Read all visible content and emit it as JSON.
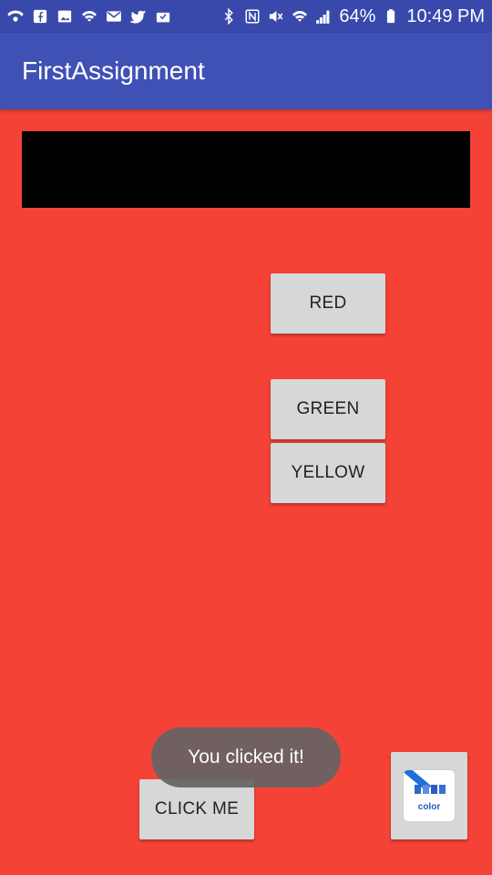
{
  "status_bar": {
    "battery": "64%",
    "time": "10:49 PM"
  },
  "app_bar": {
    "title": "FirstAssignment"
  },
  "buttons": {
    "red": "RED",
    "green": "GREEN",
    "yellow": "YELLOW",
    "click_me": "CLICK ME"
  },
  "toast": {
    "message": "You clicked it!"
  },
  "image_button": {
    "label": "color"
  },
  "colors": {
    "background": "#f44336",
    "app_bar": "#3f51b5",
    "status_bar": "#3949ab",
    "button": "#d6d7d7"
  }
}
